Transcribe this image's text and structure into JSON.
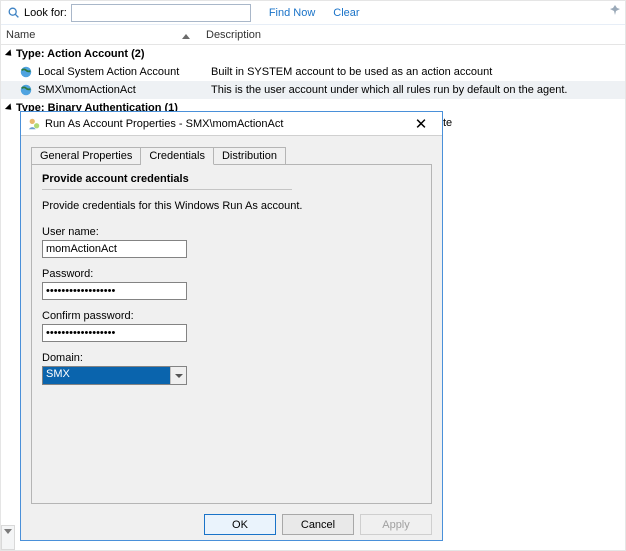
{
  "search": {
    "label": "Look for:",
    "value": "",
    "find_now": "Find Now",
    "clear": "Clear"
  },
  "columns": {
    "name": "Name",
    "description": "Description"
  },
  "groups": {
    "action_account": {
      "label": "Type: Action Account (2)",
      "items": [
        {
          "name": "Local System Action Account",
          "desc": "Built in SYSTEM account to be used as an action account"
        },
        {
          "name": "SMX\\momActionAct",
          "desc": "This is the user account under which all rules run by default on the agent."
        }
      ]
    },
    "binary_auth": {
      "label": "Type: Binary Authentication (1)"
    }
  },
  "peek_suffix": "te",
  "dialog": {
    "title": "Run As Account Properties - SMX\\momActionAct",
    "tabs": {
      "general": "General Properties",
      "credentials": "Credentials",
      "distribution": "Distribution"
    },
    "section_title": "Provide account credentials",
    "section_desc": "Provide credentials for this Windows Run As account.",
    "labels": {
      "username": "User name:",
      "password": "Password:",
      "confirm": "Confirm password:",
      "domain": "Domain:"
    },
    "values": {
      "username": "momActionAct",
      "password": "••••••••••••••••••",
      "confirm": "••••••••••••••••••",
      "domain": "SMX"
    },
    "buttons": {
      "ok": "OK",
      "cancel": "Cancel",
      "apply": "Apply"
    }
  }
}
